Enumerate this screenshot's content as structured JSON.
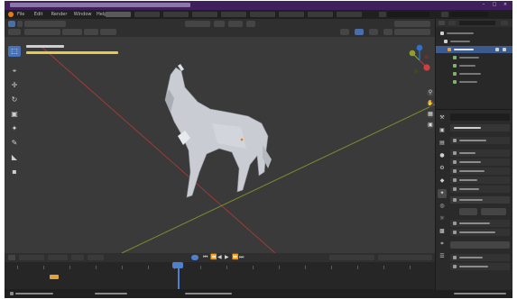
{
  "titlebar": {
    "controls": {
      "minimize": "–",
      "maximize": "□",
      "close": "×"
    }
  },
  "menubar": {
    "app_icon": "blender-logo-icon",
    "menus": [
      "File",
      "Edit",
      "Render",
      "Window",
      "Help"
    ],
    "workspaces": [
      "",
      "",
      "",
      "",
      "",
      "",
      "",
      "",
      ""
    ],
    "active_workspace": 0
  },
  "viewport": {
    "tools": [
      {
        "name": "select-box-tool",
        "glyph": "⬚",
        "active": true
      },
      {
        "name": "cursor-tool",
        "glyph": "⌖"
      },
      {
        "name": "move-tool",
        "glyph": "✛"
      },
      {
        "name": "rotate-tool",
        "glyph": "↻"
      },
      {
        "name": "scale-tool",
        "glyph": "▣"
      },
      {
        "name": "transform-tool",
        "glyph": "✦"
      },
      {
        "name": "annotate-tool",
        "glyph": "✎"
      },
      {
        "name": "measure-tool",
        "glyph": "◣"
      },
      {
        "name": "add-cube-tool",
        "glyph": "▪"
      }
    ],
    "gizmo": {
      "x": "X",
      "y": "Y",
      "z": "Z"
    },
    "nav_buttons": [
      "⚲",
      "✋",
      "▦",
      "▣"
    ]
  },
  "outliner": {},
  "properties": {
    "tabs": [
      "⚒",
      "▣",
      "▤",
      "●",
      "⚙",
      "◆",
      "✦",
      "◎",
      "☼",
      "▩",
      "⌗",
      "☰"
    ]
  },
  "timeline": {
    "playback_icons": [
      "⏮",
      "⏪",
      "◀",
      "▶",
      "⏩",
      "⏭"
    ]
  },
  "colors": {
    "accent": "#4a6ea8",
    "x_axis": "#b83a3a",
    "y_axis": "#8fa02a",
    "selection_text": "#e6c84a",
    "model_body": "#c9ccd2"
  }
}
